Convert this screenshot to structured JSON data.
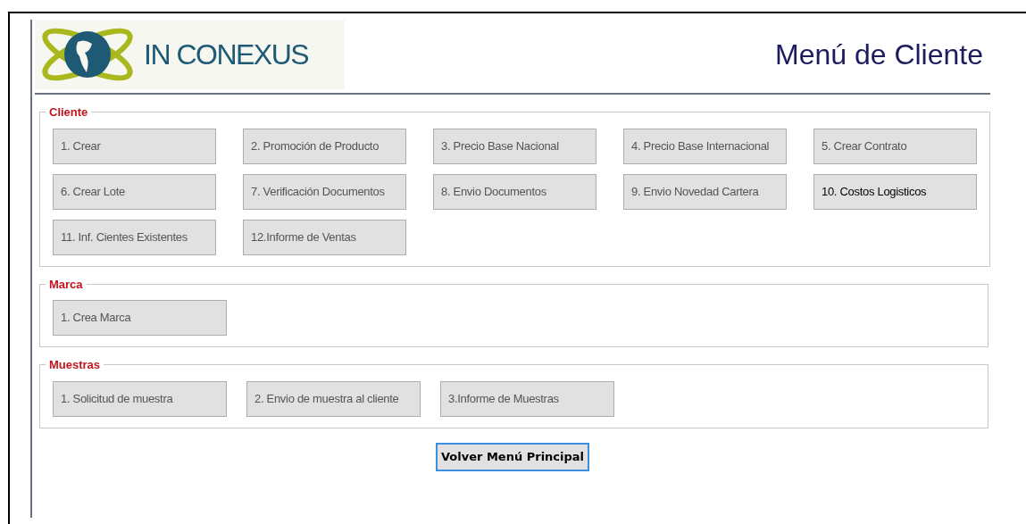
{
  "header": {
    "logo_text": "IN CONEXUS",
    "title": "Menú de Cliente"
  },
  "groups": [
    {
      "kind": "wide",
      "title": "Cliente",
      "buttons": [
        {
          "label": "1. Crear",
          "dark_text": false
        },
        {
          "label": "2. Promoción de Producto",
          "dark_text": false
        },
        {
          "label": "3. Precio Base Nacional",
          "dark_text": false
        },
        {
          "label": "4. Precio Base Internacional",
          "dark_text": false
        },
        {
          "label": "5. Crear Contrato",
          "dark_text": false
        },
        {
          "label": "6. Crear Lote",
          "dark_text": false
        },
        {
          "label": "7. Verificación Documentos",
          "dark_text": false
        },
        {
          "label": "8. Envio Documentos",
          "dark_text": false
        },
        {
          "label": "9. Envio Novedad Cartera",
          "dark_text": false
        },
        {
          "label": "10. Costos Logisticos",
          "dark_text": true
        },
        {
          "label": "11. Inf. Cientes Existentes",
          "dark_text": false
        },
        {
          "label": "12.Informe de Ventas",
          "dark_text": false
        }
      ]
    },
    {
      "kind": "narrow",
      "title": "Marca",
      "buttons": [
        {
          "label": "1. Crea Marca",
          "dark_text": false
        }
      ]
    },
    {
      "kind": "narrow",
      "title": "Muestras",
      "buttons": [
        {
          "label": "1. Solicitud de muestra",
          "dark_text": false
        },
        {
          "label": "2. Envio de muestra al cliente",
          "dark_text": false
        },
        {
          "label": "3.Informe de Muestras",
          "dark_text": false
        }
      ]
    }
  ],
  "back_button": {
    "label": "Volver Menú Principal",
    "focused": true
  }
}
